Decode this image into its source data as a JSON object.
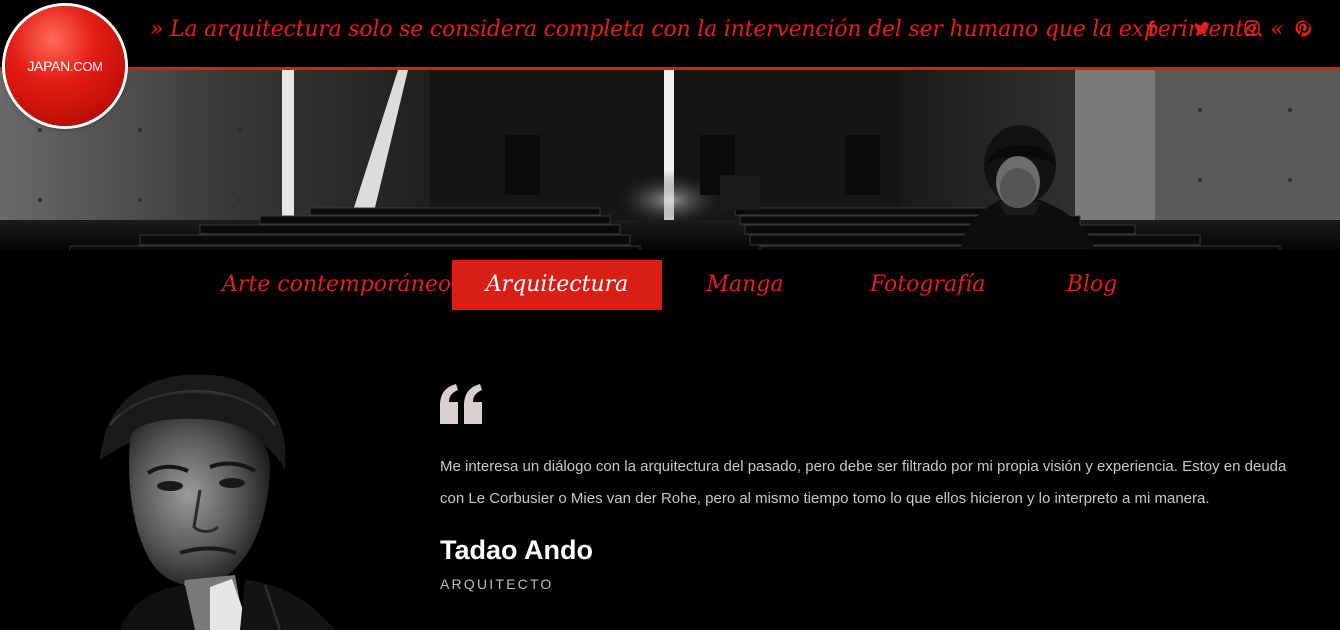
{
  "header": {
    "tagline": "» La arquitectura solo se considera completa con la intervención del ser humano que la experimenta. «",
    "logo": {
      "main": "JAPAN",
      "domain": ".COM"
    },
    "social": [
      {
        "icon": "facebook-icon"
      },
      {
        "icon": "twitter-icon"
      },
      {
        "icon": "instagram-icon"
      },
      {
        "icon": "pinterest-icon"
      }
    ],
    "accent_color": "#d71f16"
  },
  "nav": {
    "items": [
      {
        "label": "Arte contemporáneo",
        "active": false
      },
      {
        "label": "Arquitectura",
        "active": true
      },
      {
        "label": "Manga",
        "active": false
      },
      {
        "label": "Fotografía",
        "active": false
      },
      {
        "label": "Blog",
        "active": false
      }
    ]
  },
  "testimonial": {
    "quote_icon": "quote-open-icon",
    "text": "Me interesa un diálogo con la arquitectura del pasado, pero debe ser filtrado por mi propia visión y experiencia. Estoy en deuda con Le Corbusier o Mies van der Rohe, pero al mismo tiempo tomo lo que ellos hicieron y lo interpreto a mi manera.",
    "author": "Tadao Ando",
    "role": "ARQUITECTO"
  }
}
